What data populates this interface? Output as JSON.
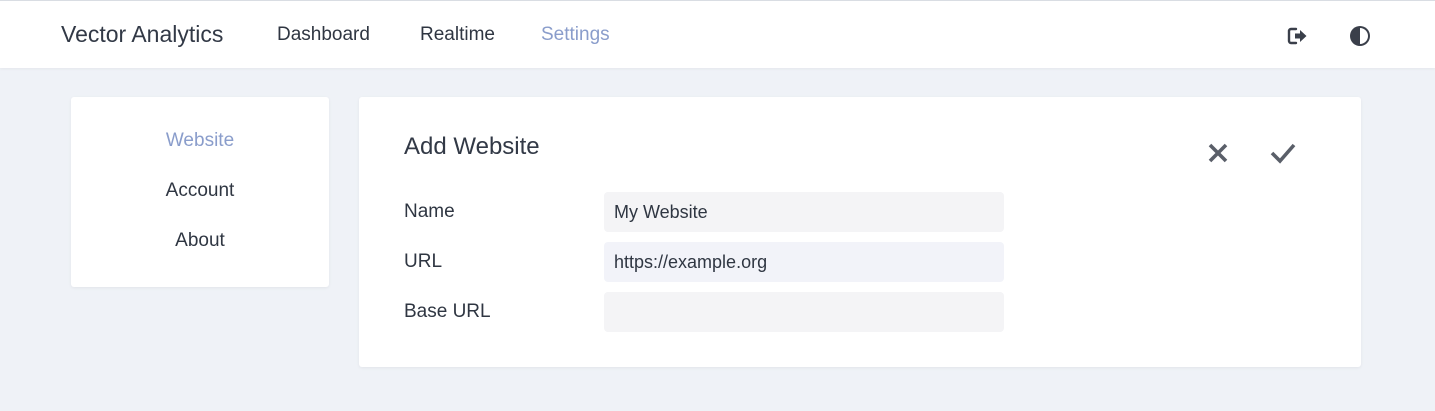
{
  "header": {
    "brand": "Vector Analytics",
    "nav": [
      {
        "label": "Dashboard",
        "active": false
      },
      {
        "label": "Realtime",
        "active": false
      },
      {
        "label": "Settings",
        "active": true
      }
    ],
    "icons": [
      "logout-icon",
      "theme-toggle-icon"
    ]
  },
  "sidebar": {
    "items": [
      {
        "label": "Website",
        "active": true
      },
      {
        "label": "Account",
        "active": false
      },
      {
        "label": "About",
        "active": false
      }
    ]
  },
  "form": {
    "title": "Add Website",
    "actions": [
      "cancel-icon",
      "confirm-icon"
    ],
    "fields": [
      {
        "label": "Name",
        "value": "My Website"
      },
      {
        "label": "URL",
        "value": "https://example.org"
      },
      {
        "label": "Base URL",
        "value": ""
      }
    ]
  },
  "colors": {
    "accent": "#8a9dcb",
    "text": "#2f3642",
    "background": "#eff2f7",
    "input_bg": "#f4f4f6"
  }
}
